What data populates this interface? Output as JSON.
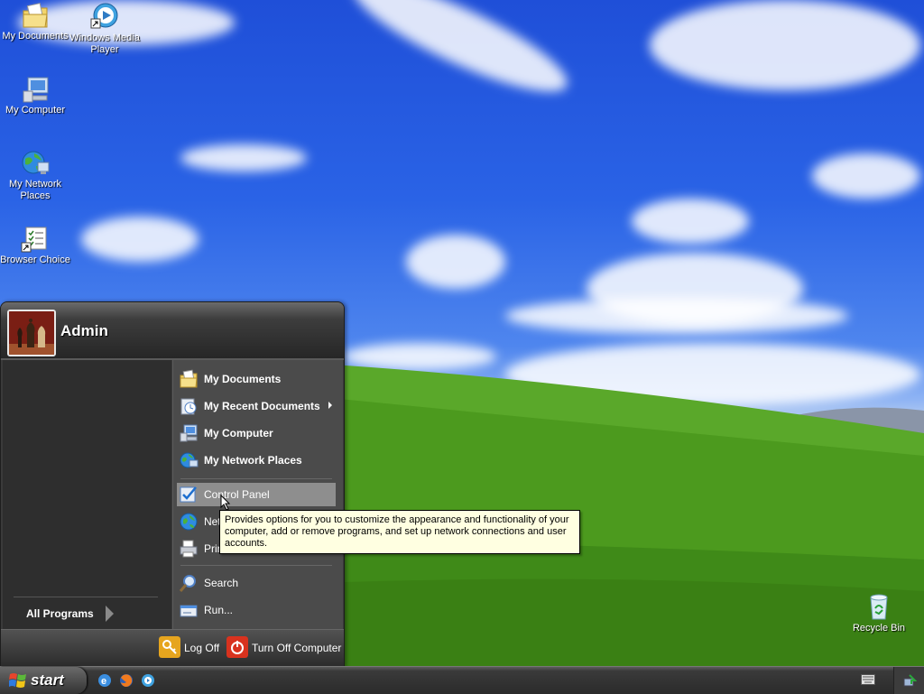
{
  "desktop": {
    "icons": [
      {
        "label": "My Documents",
        "icon": "my-documents-folder-icon"
      },
      {
        "label": "Windows Media Player",
        "icon": "windows-media-player-icon"
      },
      {
        "label": "My Computer",
        "icon": "my-computer-icon"
      },
      {
        "label": "My Network Places",
        "icon": "my-network-places-icon"
      },
      {
        "label": "Browser Choice",
        "icon": "browser-choice-icon"
      },
      {
        "label": "Recycle Bin",
        "icon": "recycle-bin-icon"
      }
    ]
  },
  "start_menu": {
    "user_name": "Admin",
    "all_programs_label": "All Programs",
    "right_items": [
      {
        "label": "My Documents",
        "icon": "my-documents-icon",
        "bold": true
      },
      {
        "label": "My Recent Documents",
        "icon": "recent-documents-icon",
        "bold": true,
        "has_submenu": true
      },
      {
        "label": "My Computer",
        "icon": "my-computer-icon",
        "bold": true
      },
      {
        "label": "My Network Places",
        "icon": "network-places-icon",
        "bold": true
      },
      {
        "label": "Control Panel",
        "icon": "control-panel-icon",
        "highlighted": true
      },
      {
        "label": "Net",
        "icon": "network-connections-icon"
      },
      {
        "label": "Prin",
        "icon": "printers-icon"
      },
      {
        "label": "Search",
        "icon": "search-icon"
      },
      {
        "label": "Run...",
        "icon": "run-icon"
      }
    ],
    "log_off_label": "Log Off",
    "turn_off_label": "Turn Off Computer"
  },
  "tooltip": {
    "text": "Provides options for you to customize the appearance and functionality of your computer, add or remove programs, and set up network connections and user accounts."
  },
  "taskbar": {
    "start_label": "start",
    "quick_launch": [
      "internet-explorer-icon",
      "firefox-icon",
      "media-player-icon"
    ],
    "tray_icons": [
      "keyboard-icon",
      "safely-remove-hardware-icon"
    ]
  },
  "colors": {
    "sky": "#2a63e6",
    "grass": "#4c9a1e",
    "menu_dark": "#2e2e2e",
    "menu_right": "#4b4b4b",
    "highlight": "#8e8e8e",
    "tooltip_bg": "#ffffe1"
  }
}
